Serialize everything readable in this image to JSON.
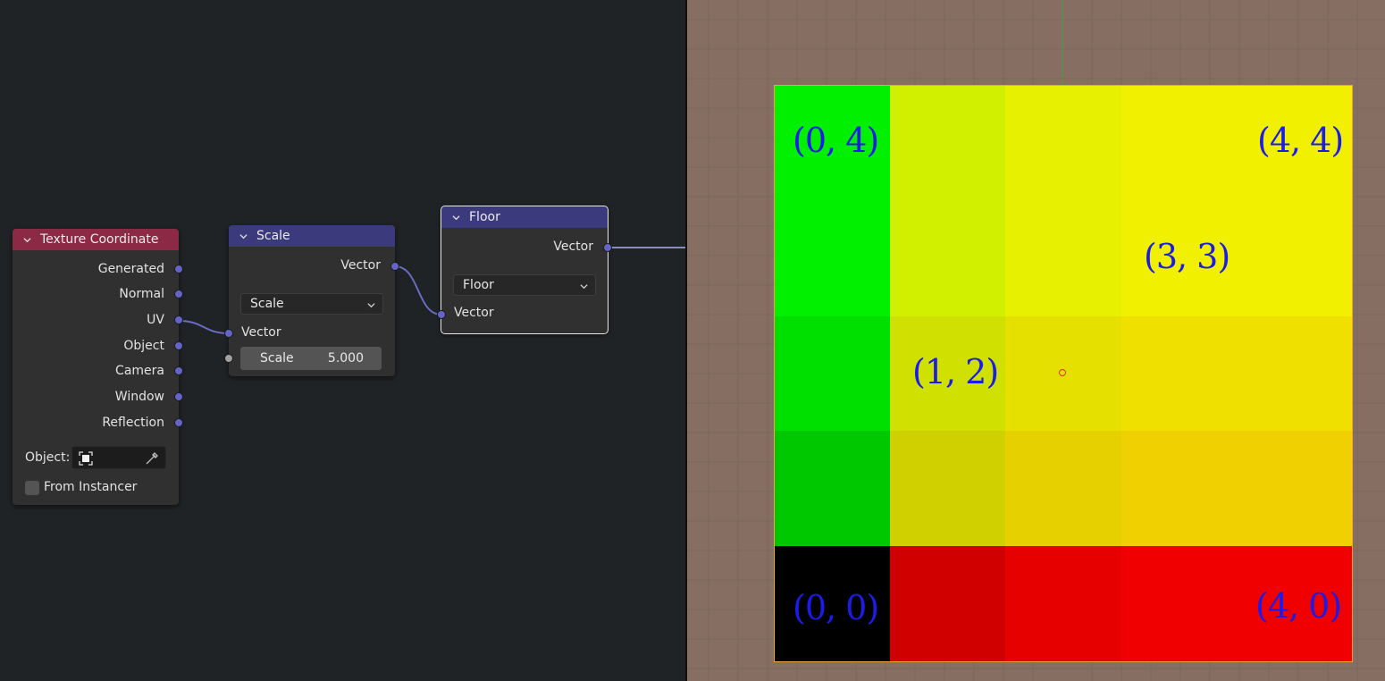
{
  "node_editor": {
    "nodes": {
      "texture_coordinate": {
        "title": "Texture Coordinate",
        "outputs": [
          "Generated",
          "Normal",
          "UV",
          "Object",
          "Camera",
          "Window",
          "Reflection"
        ],
        "object_label": "Object:",
        "from_instancer_label": "From Instancer"
      },
      "scale": {
        "title": "Scale",
        "output": "Vector",
        "operation": "Scale",
        "input_vector": "Vector",
        "scale_label": "Scale",
        "scale_value": "5.000"
      },
      "floor": {
        "title": "Floor",
        "output": "Vector",
        "operation": "Floor",
        "input_vector": "Vector"
      }
    },
    "colors": {
      "input_header": "#8c2a45",
      "vector_header": "#3b3a7c",
      "socket_vector": "#6363c8",
      "wire": "#6b6bc4"
    }
  },
  "viewport": {
    "background": "#866e62",
    "grid_colors": [
      [
        "#00f000",
        "#d0f000",
        "#e6f000",
        "#f0f000",
        "#f0f000"
      ],
      [
        "#00f000",
        "#d0f000",
        "#e6f000",
        "#f0f000",
        "#f0f000"
      ],
      [
        "#00e000",
        "#d0e000",
        "#e6e000",
        "#f0e000",
        "#f0e000"
      ],
      [
        "#00c800",
        "#d0d000",
        "#e6d000",
        "#f0d000",
        "#f0d000"
      ],
      [
        "#000000",
        "#d00000",
        "#e60000",
        "#f00000",
        "#f00000"
      ]
    ],
    "labels": {
      "top_left": "(0, 4)",
      "top_right": "(4, 4)",
      "mid_right": "(3, 3)",
      "center": "(1, 2)",
      "bottom_left": "(0, 0)",
      "bottom_right": "(4, 0)"
    },
    "outline_color": "#f5a23a"
  }
}
